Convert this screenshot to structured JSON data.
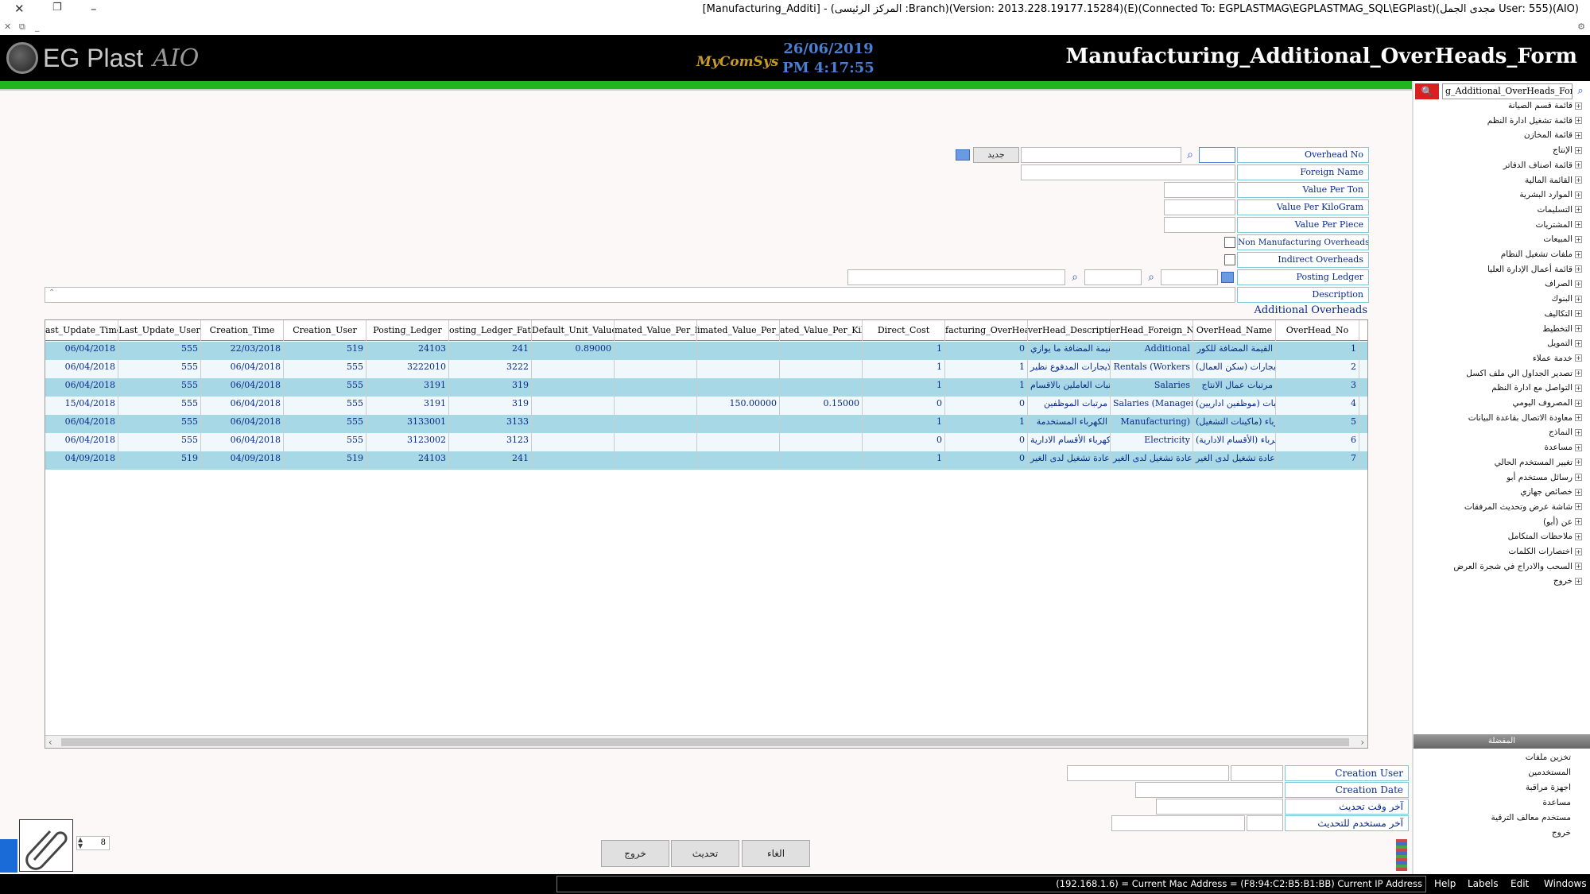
{
  "window": {
    "title": "[Manufacturing_Additi] - (المركز الرئيسى :Branch)(Version: 2013.228.19177.15284)(E)(Connected To: EGPLASTMAG\\EGPLASTMAG_SQL\\EGPlast)(مجدى الجمل User: 555)(AIO)"
  },
  "header": {
    "logo_text": "EG Plast",
    "logo_sig": "AIO",
    "company_mark": "MyComSys",
    "date": "26/06/2019",
    "time": "PM 4:17:55",
    "form_title": "Manufacturing_Additional_OverHeads_Form"
  },
  "form": {
    "overhead_no_label": "Overhead No",
    "new_button": "جديد",
    "foreign_name_label": "Foreign Name",
    "value_per_ton_label": "Value Per Ton",
    "value_per_kg_label": "Value Per KiloGram",
    "value_per_piece_label": "Value Per Piece",
    "non_manufacturing_label": "Non Manufacturing Overheads",
    "indirect_label": "Indirect Overheads",
    "posting_ledger_label": "Posting Ledger",
    "description_label": "Description",
    "section_title": "Additional Overheads"
  },
  "grid": {
    "columns": [
      "ast_Update_Time",
      "Last_Update_User",
      "Creation_Time",
      "Creation_User",
      "Posting_Ledger",
      "osting_Ledger_Fathe",
      "Default_Unit_Value",
      "mated_Value_Per_P",
      "imated_Value_Per_T",
      "ated_Value_Per_Kilc",
      "Direct_Cost",
      "facturing_OverHead_",
      "verHead_Descriptio",
      "erHead_Foreign_Nai",
      "OverHead_Name",
      "OverHead_No"
    ],
    "rows": [
      {
        "lut": "06/04/2018",
        "luu": "555",
        "ct": "22/03/2018",
        "cu": "519",
        "pl": "24103",
        "plf": "241",
        "duv": "0.89000",
        "vpp": "",
        "vpt": "",
        "vpk": "",
        "dc": "1",
        "mo": "0",
        "desc": "القيمة المضافة ما يوازي",
        "fn": "Additional",
        "name": "القيمة المضافة للكور",
        "no": "1"
      },
      {
        "lut": "06/04/2018",
        "luu": "555",
        "ct": "06/04/2018",
        "cu": "555",
        "pl": "3222010",
        "plf": "3222",
        "duv": "",
        "vpp": "",
        "vpt": "",
        "vpk": "",
        "dc": "1",
        "mo": "1",
        "desc": "الايجارات المدفوع نظير",
        "fn": "Rentals (Workers",
        "name": "إيجارات (سكن العمال)",
        "no": "2"
      },
      {
        "lut": "06/04/2018",
        "luu": "555",
        "ct": "06/04/2018",
        "cu": "555",
        "pl": "3191",
        "plf": "319",
        "duv": "",
        "vpp": "",
        "vpt": "",
        "vpk": "",
        "dc": "1",
        "mo": "1",
        "desc": "مرتبات العاملين بالاقسام",
        "fn": "Salaries",
        "name": "مرتبات عمال الانتاج",
        "no": "3"
      },
      {
        "lut": "15/04/2018",
        "luu": "555",
        "ct": "06/04/2018",
        "cu": "555",
        "pl": "3191",
        "plf": "319",
        "duv": "",
        "vpp": "",
        "vpt": "150.00000",
        "vpk": "0.15000",
        "dc": "0",
        "mo": "0",
        "desc": "مرتبات الموظفين",
        "fn": "Salaries (Managerial",
        "name": "مرتبات (موظفين اداريين)",
        "no": "4"
      },
      {
        "lut": "06/04/2018",
        "luu": "555",
        "ct": "06/04/2018",
        "cu": "555",
        "pl": "3133001",
        "plf": "3133",
        "duv": "",
        "vpp": "",
        "vpt": "",
        "vpk": "",
        "dc": "1",
        "mo": "1",
        "desc": "الكهرباء المستخدمة",
        "fn": "Manufacturing)",
        "name": "كهرباء (ماكينات التشغيل)",
        "no": "5"
      },
      {
        "lut": "06/04/2018",
        "luu": "555",
        "ct": "06/04/2018",
        "cu": "555",
        "pl": "3123002",
        "plf": "3123",
        "duv": "",
        "vpp": "",
        "vpt": "",
        "vpk": "",
        "dc": "0",
        "mo": "0",
        "desc": "كهرباء الأقسام الادارية",
        "fn": "Electricity",
        "name": "كهرباء (الأقسام الادارية)",
        "no": "6"
      },
      {
        "lut": "04/09/2018",
        "luu": "519",
        "ct": "04/09/2018",
        "cu": "519",
        "pl": "24103",
        "plf": "241",
        "duv": "",
        "vpp": "",
        "vpt": "",
        "vpk": "",
        "dc": "1",
        "mo": "0",
        "desc": "اعادة تشغيل لدى الغير",
        "fn": "اعادة تشغيل لدى الغير",
        "name": "اعادة تشغيل لدى الغير",
        "no": "7"
      }
    ]
  },
  "footer_form": {
    "creation_user": "Creation User",
    "creation_date": "Creation Date",
    "last_update_time": "آخر وقت تحديث",
    "last_update_user": "آخر مستخدم للتحديث",
    "spin_value": "8"
  },
  "buttons": {
    "exit": "خروج",
    "refresh": "تحديث",
    "cancel": "الغاء"
  },
  "sidebar": {
    "search_value": "g_Additional_OverHeads_Form",
    "tree": [
      "قائمة قسم الصيانة",
      "قائمة تشغيل ادارة النظم",
      "قائمة المخازن",
      "الإنتاج",
      "قائمة اصناف الدفاتر",
      "القائمة المالية",
      "الموارد البشرية",
      "التسليمات",
      "المشتريات",
      "المبيعات",
      "ملفات تشغيل النظام",
      "قائمة أعمال الإدارة العليا",
      "الصراف",
      "البنوك",
      "التكاليف",
      "التخطيط",
      "التمويل",
      "خدمة عملاء",
      "تصدير الجداول الي ملف اكسل",
      "التواصل مع ادارة النظم",
      "المصروف اليومي",
      "معاودة الاتصال بقاعدة البيانات",
      "النماذج",
      "مساعدة",
      "تغيير المستخدم الحالي",
      "رسائل مستخدم أبو",
      "خصائص جهازي",
      "شاشة عرض وتحديث المرفقات",
      "عن (أبو)",
      "ملاحظات المتكامل",
      "اختصارات الكلمات",
      "السحب والادراج في شجرة العرض",
      "خروج"
    ],
    "bottom_header": "المفضلة",
    "bottom": [
      "تخزين ملفات",
      "المستخدمين",
      "اجهزة مراقبة",
      "مساعدة",
      "مستخدم معالف الترقية",
      "خروج"
    ]
  },
  "status": {
    "text": "(192.168.1.6) = Current Mac Address = (F8:94:C2:B5:B1:BB) Current IP Address",
    "menu": [
      "Help",
      "Labels",
      "Edit",
      "Windows"
    ]
  },
  "colors": {
    "row_alt": "#a6d8e6",
    "accent_green": "#1fb51f",
    "label_text": "#0a2a8a"
  }
}
